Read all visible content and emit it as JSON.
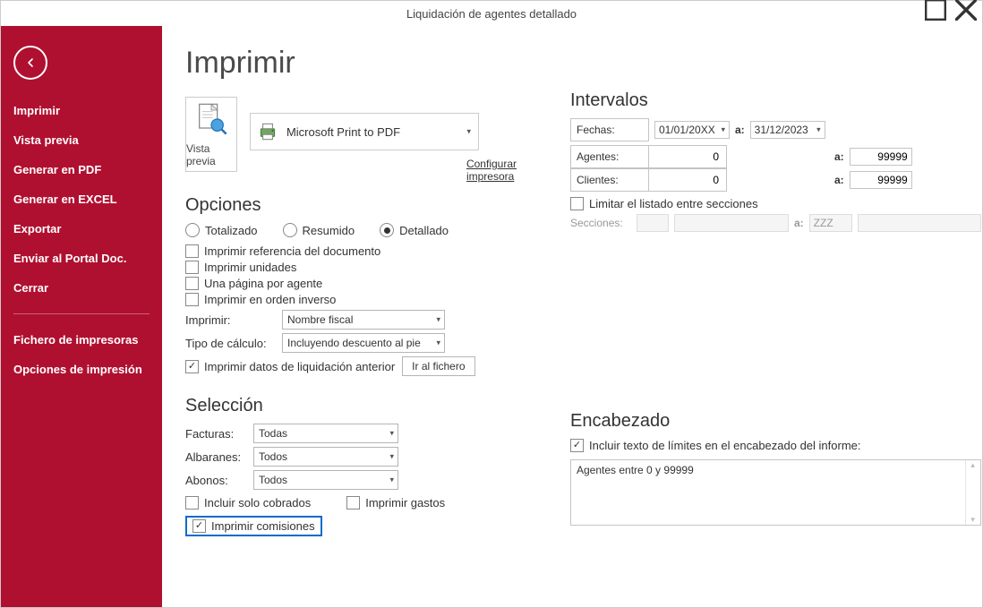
{
  "window": {
    "title": "Liquidación de agentes detallado"
  },
  "sidebar": {
    "items": [
      "Imprimir",
      "Vista previa",
      "Generar en PDF",
      "Generar en EXCEL",
      "Exportar",
      "Enviar al Portal Doc.",
      "Cerrar"
    ],
    "items2": [
      "Fichero de impresoras",
      "Opciones de impresión"
    ]
  },
  "page_title": "Imprimir",
  "preview_button": "Vista previa",
  "printer": {
    "name": "Microsoft Print to PDF"
  },
  "configure_link": "Configurar impresora",
  "opciones": {
    "title": "Opciones",
    "radios": {
      "totalizado": "Totalizado",
      "resumido": "Resumido",
      "detallado": "Detallado",
      "selected": "detallado"
    },
    "chk_ref_doc": "Imprimir referencia del documento",
    "chk_unidades": "Imprimir unidades",
    "chk_una_pagina": "Una página por agente",
    "chk_orden_inverso": "Imprimir en orden inverso",
    "imprimir_label": "Imprimir:",
    "imprimir_value": "Nombre fiscal",
    "tipo_calculo_label": "Tipo de cálculo:",
    "tipo_calculo_value": "Incluyendo descuento al pie",
    "chk_liq_anterior": "Imprimir datos de liquidación anterior",
    "ir_al_fichero": "Ir al fichero"
  },
  "seleccion": {
    "title": "Selección",
    "facturas_label": "Facturas:",
    "facturas_value": "Todas",
    "albaranes_label": "Albaranes:",
    "albaranes_value": "Todos",
    "abonos_label": "Abonos:",
    "abonos_value": "Todos",
    "chk_solo_cobrados": "Incluir solo cobrados",
    "chk_imprimir_gastos": "Imprimir gastos",
    "chk_imprimir_comisiones": "Imprimir comisiones"
  },
  "intervalos": {
    "title": "Intervalos",
    "fechas_label": "Fechas:",
    "fecha_desde": "01/01/20XX",
    "a_label": "a:",
    "fecha_hasta": "31/12/2023",
    "agentes_label": "Agentes:",
    "agentes_desde": "0",
    "agentes_hasta": "99999",
    "clientes_label": "Clientes:",
    "clientes_desde": "0",
    "clientes_hasta": "99999",
    "chk_limitar": "Limitar el listado entre secciones",
    "secciones_label": "Secciones:",
    "secciones_hasta": "ZZZ"
  },
  "encabezado": {
    "title": "Encabezado",
    "chk_incluir_texto": "Incluir texto de límites en el encabezado del informe:",
    "text": "Agentes entre 0 y 99999"
  }
}
